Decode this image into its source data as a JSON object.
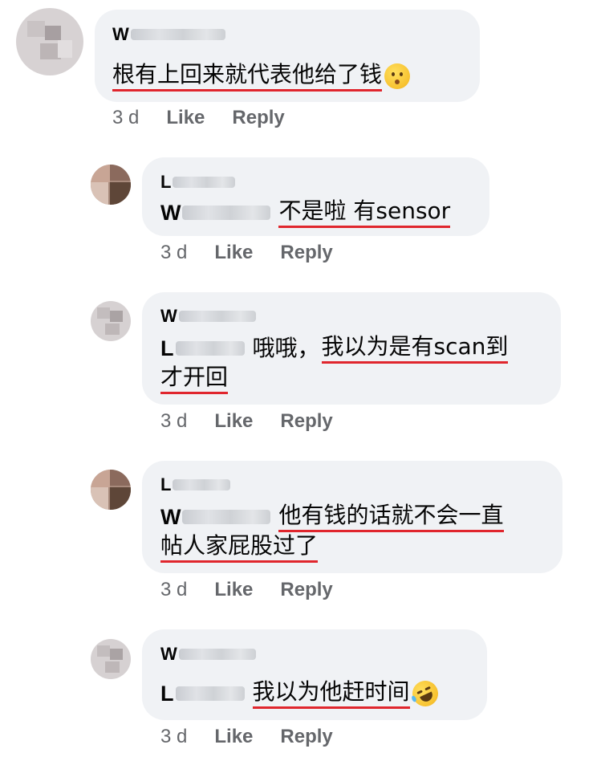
{
  "comments": [
    {
      "author_initial": "W",
      "text": "根有上回来就代表他给了钱",
      "emoji": "kissing-face-icon",
      "time": "3 d",
      "like": "Like",
      "reply": "Reply"
    },
    {
      "author_initial": "L",
      "mention_initial": "W",
      "text": "不是啦 有sensor",
      "time": "3 d",
      "like": "Like",
      "reply": "Reply"
    },
    {
      "author_initial": "W",
      "mention_initial": "L",
      "text_pre": "哦哦，",
      "text_line1": "我以为是有scan到",
      "text_line2": "才开回",
      "time": "3 d",
      "like": "Like",
      "reply": "Reply"
    },
    {
      "author_initial": "L",
      "mention_initial": "W",
      "text_line1": "他有钱的话就不会一直",
      "text_line2": "帖人家屁股过了",
      "time": "3 d",
      "like": "Like",
      "reply": "Reply"
    },
    {
      "author_initial": "W",
      "mention_initial": "L",
      "text": "我以为他赶时间",
      "emoji": "rolling-on-floor-laughing-icon",
      "time": "3 d",
      "like": "Like",
      "reply": "Reply"
    }
  ],
  "colors": {
    "bubble": "#f0f2f5",
    "underline": "#e0262d",
    "meta": "#65676b"
  }
}
